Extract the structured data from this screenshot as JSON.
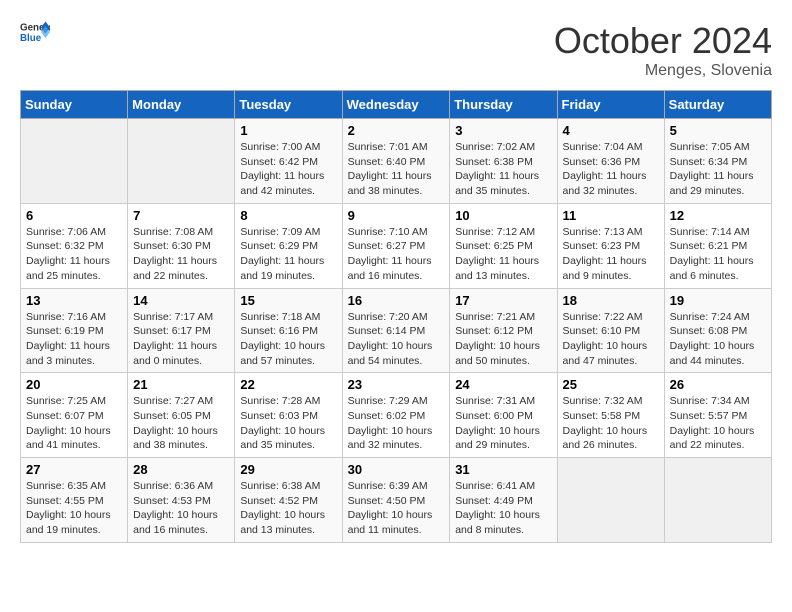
{
  "header": {
    "logo_general": "General",
    "logo_blue": "Blue",
    "month_year": "October 2024",
    "location": "Menges, Slovenia"
  },
  "days_of_week": [
    "Sunday",
    "Monday",
    "Tuesday",
    "Wednesday",
    "Thursday",
    "Friday",
    "Saturday"
  ],
  "weeks": [
    [
      {
        "day": "",
        "empty": true
      },
      {
        "day": "",
        "empty": true
      },
      {
        "day": "1",
        "sunrise": "7:00 AM",
        "sunset": "6:42 PM",
        "daylight": "11 hours and 42 minutes."
      },
      {
        "day": "2",
        "sunrise": "7:01 AM",
        "sunset": "6:40 PM",
        "daylight": "11 hours and 38 minutes."
      },
      {
        "day": "3",
        "sunrise": "7:02 AM",
        "sunset": "6:38 PM",
        "daylight": "11 hours and 35 minutes."
      },
      {
        "day": "4",
        "sunrise": "7:04 AM",
        "sunset": "6:36 PM",
        "daylight": "11 hours and 32 minutes."
      },
      {
        "day": "5",
        "sunrise": "7:05 AM",
        "sunset": "6:34 PM",
        "daylight": "11 hours and 29 minutes."
      }
    ],
    [
      {
        "day": "6",
        "sunrise": "7:06 AM",
        "sunset": "6:32 PM",
        "daylight": "11 hours and 25 minutes."
      },
      {
        "day": "7",
        "sunrise": "7:08 AM",
        "sunset": "6:30 PM",
        "daylight": "11 hours and 22 minutes."
      },
      {
        "day": "8",
        "sunrise": "7:09 AM",
        "sunset": "6:29 PM",
        "daylight": "11 hours and 19 minutes."
      },
      {
        "day": "9",
        "sunrise": "7:10 AM",
        "sunset": "6:27 PM",
        "daylight": "11 hours and 16 minutes."
      },
      {
        "day": "10",
        "sunrise": "7:12 AM",
        "sunset": "6:25 PM",
        "daylight": "11 hours and 13 minutes."
      },
      {
        "day": "11",
        "sunrise": "7:13 AM",
        "sunset": "6:23 PM",
        "daylight": "11 hours and 9 minutes."
      },
      {
        "day": "12",
        "sunrise": "7:14 AM",
        "sunset": "6:21 PM",
        "daylight": "11 hours and 6 minutes."
      }
    ],
    [
      {
        "day": "13",
        "sunrise": "7:16 AM",
        "sunset": "6:19 PM",
        "daylight": "11 hours and 3 minutes."
      },
      {
        "day": "14",
        "sunrise": "7:17 AM",
        "sunset": "6:17 PM",
        "daylight": "11 hours and 0 minutes."
      },
      {
        "day": "15",
        "sunrise": "7:18 AM",
        "sunset": "6:16 PM",
        "daylight": "10 hours and 57 minutes."
      },
      {
        "day": "16",
        "sunrise": "7:20 AM",
        "sunset": "6:14 PM",
        "daylight": "10 hours and 54 minutes."
      },
      {
        "day": "17",
        "sunrise": "7:21 AM",
        "sunset": "6:12 PM",
        "daylight": "10 hours and 50 minutes."
      },
      {
        "day": "18",
        "sunrise": "7:22 AM",
        "sunset": "6:10 PM",
        "daylight": "10 hours and 47 minutes."
      },
      {
        "day": "19",
        "sunrise": "7:24 AM",
        "sunset": "6:08 PM",
        "daylight": "10 hours and 44 minutes."
      }
    ],
    [
      {
        "day": "20",
        "sunrise": "7:25 AM",
        "sunset": "6:07 PM",
        "daylight": "10 hours and 41 minutes."
      },
      {
        "day": "21",
        "sunrise": "7:27 AM",
        "sunset": "6:05 PM",
        "daylight": "10 hours and 38 minutes."
      },
      {
        "day": "22",
        "sunrise": "7:28 AM",
        "sunset": "6:03 PM",
        "daylight": "10 hours and 35 minutes."
      },
      {
        "day": "23",
        "sunrise": "7:29 AM",
        "sunset": "6:02 PM",
        "daylight": "10 hours and 32 minutes."
      },
      {
        "day": "24",
        "sunrise": "7:31 AM",
        "sunset": "6:00 PM",
        "daylight": "10 hours and 29 minutes."
      },
      {
        "day": "25",
        "sunrise": "7:32 AM",
        "sunset": "5:58 PM",
        "daylight": "10 hours and 26 minutes."
      },
      {
        "day": "26",
        "sunrise": "7:34 AM",
        "sunset": "5:57 PM",
        "daylight": "10 hours and 22 minutes."
      }
    ],
    [
      {
        "day": "27",
        "sunrise": "6:35 AM",
        "sunset": "4:55 PM",
        "daylight": "10 hours and 19 minutes."
      },
      {
        "day": "28",
        "sunrise": "6:36 AM",
        "sunset": "4:53 PM",
        "daylight": "10 hours and 16 minutes."
      },
      {
        "day": "29",
        "sunrise": "6:38 AM",
        "sunset": "4:52 PM",
        "daylight": "10 hours and 13 minutes."
      },
      {
        "day": "30",
        "sunrise": "6:39 AM",
        "sunset": "4:50 PM",
        "daylight": "10 hours and 11 minutes."
      },
      {
        "day": "31",
        "sunrise": "6:41 AM",
        "sunset": "4:49 PM",
        "daylight": "10 hours and 8 minutes."
      },
      {
        "day": "",
        "empty": true
      },
      {
        "day": "",
        "empty": true
      }
    ]
  ]
}
